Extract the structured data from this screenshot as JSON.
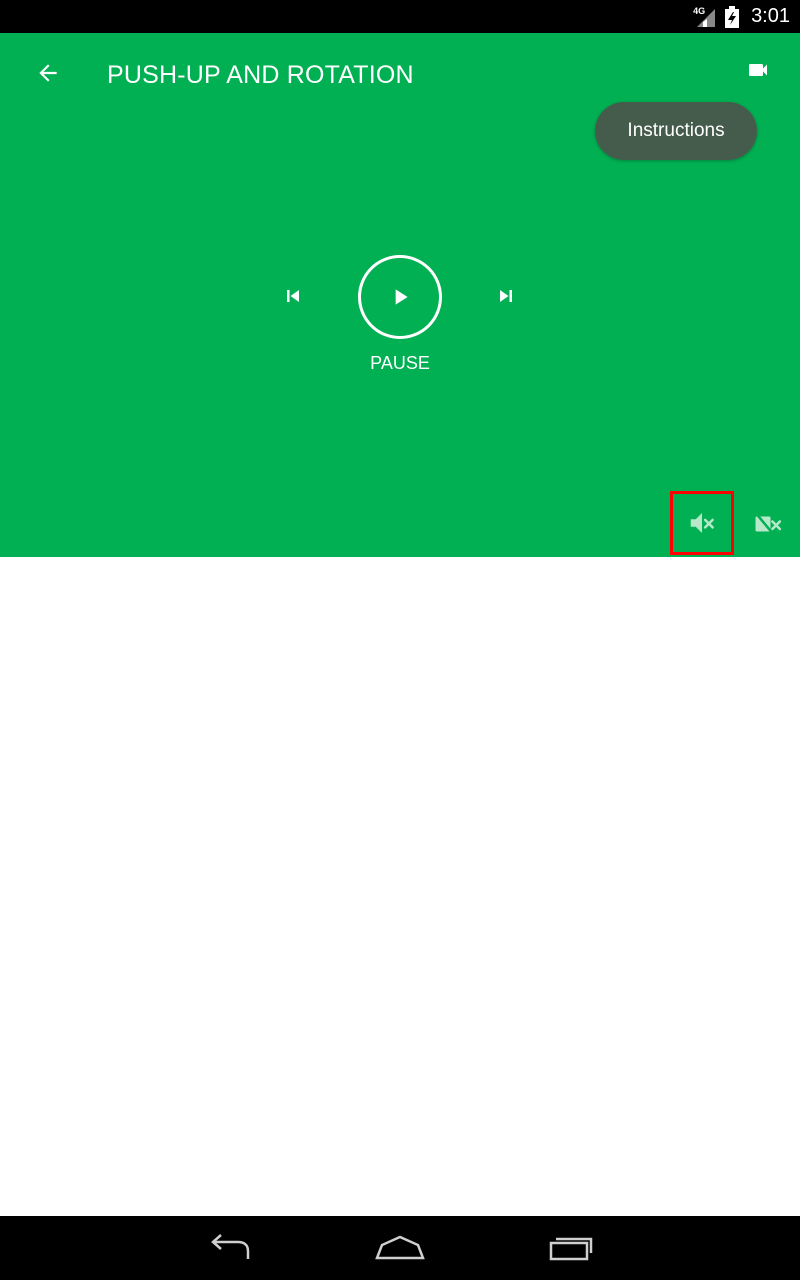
{
  "status_bar": {
    "network_type": "4G",
    "time": "3:01",
    "icons": [
      "signal-icon",
      "battery-icon"
    ]
  },
  "header": {
    "title": "PUSH-UP AND ROTATION",
    "icons": [
      "back-arrow-icon",
      "video-camera-icon"
    ]
  },
  "instructions": {
    "label": "Instructions"
  },
  "playback": {
    "status_label": "PAUSE",
    "icons": [
      "skip-previous-icon",
      "play-icon",
      "skip-next-icon"
    ]
  },
  "toggles": {
    "icons": [
      "volume-off-icon",
      "video-off-icon"
    ],
    "highlight_color": "#ff0000"
  },
  "navigation_bar": {
    "icons": [
      "back-icon",
      "home-icon",
      "recents-icon"
    ]
  },
  "colors": {
    "player_background": "#00b052",
    "instructions_background": "#455c4d",
    "status_bar": "#000000"
  }
}
